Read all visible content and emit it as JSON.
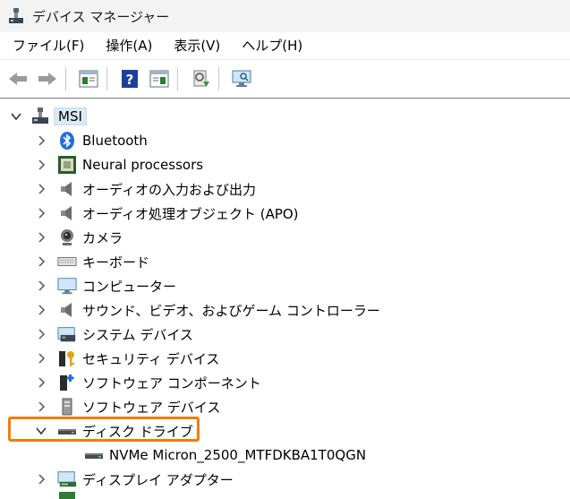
{
  "window": {
    "title": "デバイス マネージャー"
  },
  "menu": [
    "ファイル(F)",
    "操作(A)",
    "表示(V)",
    "ヘルプ(H)"
  ],
  "toolbar": {
    "buttons": [
      "back-arrow-icon",
      "forward-arrow-icon",
      "properties-icon",
      "help-icon",
      "details-pane-icon",
      "update-driver-icon",
      "scan-hardware-icon"
    ]
  },
  "tree": {
    "root": "MSI",
    "categories": [
      {
        "label": "Bluetooth",
        "icon": "bluetooth-icon",
        "expanded": false
      },
      {
        "label": "Neural processors",
        "icon": "npu-chip-icon",
        "expanded": false
      },
      {
        "label": "オーディオの入力および出力",
        "icon": "speaker-icon",
        "expanded": false
      },
      {
        "label": "オーディオ処理オブジェクト (APO)",
        "icon": "speaker-icon",
        "expanded": false
      },
      {
        "label": "カメラ",
        "icon": "camera-icon",
        "expanded": false
      },
      {
        "label": "キーボード",
        "icon": "keyboard-icon",
        "expanded": false
      },
      {
        "label": "コンピューター",
        "icon": "monitor-icon",
        "expanded": false
      },
      {
        "label": "サウンド、ビデオ、およびゲーム コントローラー",
        "icon": "speaker-icon",
        "expanded": false
      },
      {
        "label": "システム デバイス",
        "icon": "system-device-icon",
        "expanded": false
      },
      {
        "label": "セキュリティ デバイス",
        "icon": "security-key-icon",
        "expanded": false
      },
      {
        "label": "ソフトウェア コンポーネント",
        "icon": "software-component-icon",
        "expanded": false
      },
      {
        "label": "ソフトウェア デバイス",
        "icon": "software-device-icon",
        "expanded": false
      },
      {
        "label": "ディスク ドライブ",
        "icon": "disk-drive-icon",
        "expanded": true,
        "children": [
          {
            "label": "NVMe Micron_2500_MTFDKBA1T0QGN",
            "icon": "disk-drive-icon"
          }
        ]
      },
      {
        "label": "ディスプレイ アダプター",
        "icon": "display-adapter-icon",
        "expanded": false
      }
    ]
  },
  "colors": {
    "highlight_border": "#f57c00",
    "selection_bg": "#dbe9f7"
  }
}
